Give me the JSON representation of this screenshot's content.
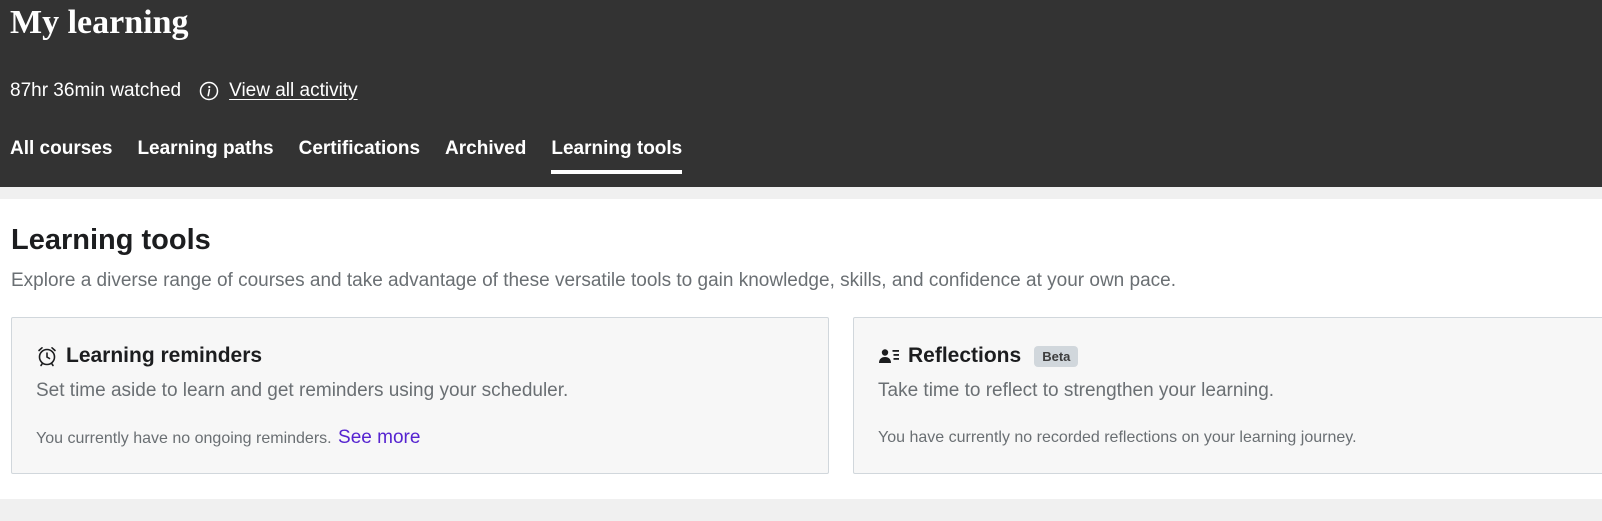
{
  "header": {
    "title": "My learning",
    "watched": "87hr 36min watched",
    "view_all_label": " View all activity",
    "info_icon": "info-icon"
  },
  "tabs": [
    {
      "label": "All courses",
      "active": false
    },
    {
      "label": "Learning paths",
      "active": false
    },
    {
      "label": "Certifications",
      "active": false
    },
    {
      "label": "Archived",
      "active": false
    },
    {
      "label": "Learning tools",
      "active": true
    }
  ],
  "section": {
    "title": "Learning tools",
    "description": "Explore a diverse range of courses and take advantage of these versatile tools to gain knowledge, skills, and confidence at your own pace."
  },
  "cards": [
    {
      "icon": "alarm-clock-icon",
      "title": "Learning reminders",
      "description": "Set time aside to learn and get reminders using your scheduler.",
      "note": "You currently have no ongoing reminders.",
      "link": "See more"
    },
    {
      "icon": "reflections-icon",
      "title": "Reflections",
      "badge": "Beta",
      "description": "Take time to reflect to strengthen your learning.",
      "note": "You have currently no recorded reflections on your learning journey."
    }
  ],
  "colors": {
    "header_bg": "#333333",
    "link_purple": "#5624d0",
    "muted_text": "#6a6f73"
  }
}
